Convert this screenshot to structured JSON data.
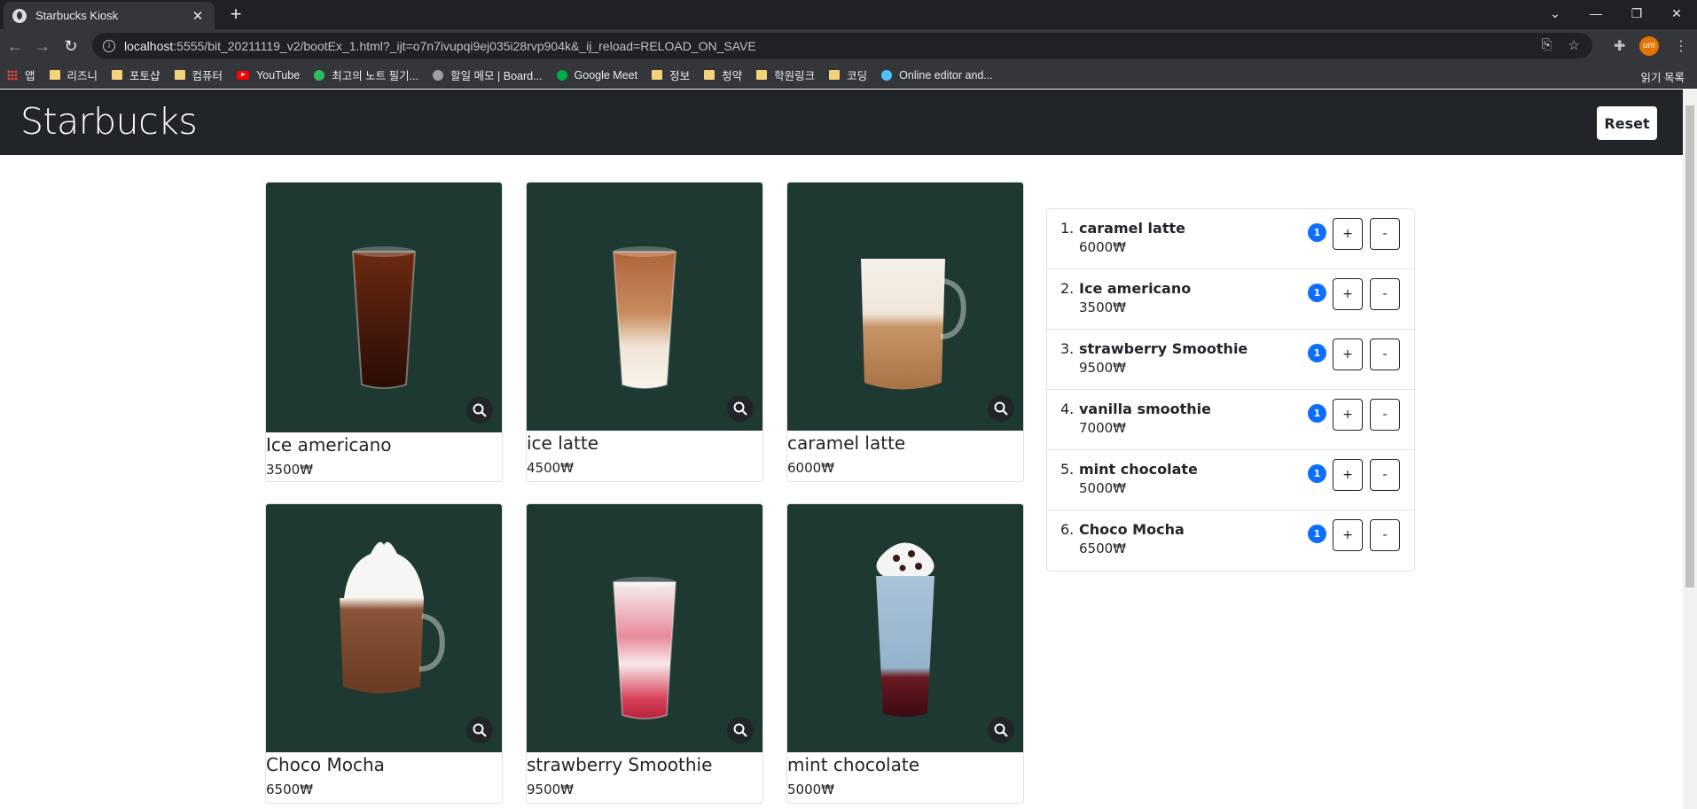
{
  "browser": {
    "tab_title": "Starbucks Kiosk",
    "url_host": "localhost",
    "url_rest": ":5555/bit_20211119_v2/bootEx_1.html?_ijt=o7n7ivupqi9ej035i28rvp904k&_ij_reload=RELOAD_ON_SAVE",
    "profile_initials": "um",
    "bookmarks": [
      {
        "label": "앱",
        "icon": "apps-icon"
      },
      {
        "label": "리즈니",
        "icon": "folder-icon"
      },
      {
        "label": "포토샵",
        "icon": "folder-icon"
      },
      {
        "label": "컴퓨터",
        "icon": "folder-icon"
      },
      {
        "label": "YouTube",
        "icon": "youtube-icon"
      },
      {
        "label": "최고의 노트 필기...",
        "icon": "evernote-icon"
      },
      {
        "label": "할일 메모 | Board...",
        "icon": "check-icon"
      },
      {
        "label": "Google Meet",
        "icon": "meet-icon"
      },
      {
        "label": "정보",
        "icon": "folder-icon"
      },
      {
        "label": "청약",
        "icon": "folder-icon"
      },
      {
        "label": "학원링크",
        "icon": "folder-icon"
      },
      {
        "label": "코딩",
        "icon": "folder-icon"
      },
      {
        "label": "Online editor and...",
        "icon": "editor-icon"
      }
    ],
    "reading_list": "읽기 목록"
  },
  "header": {
    "brand": "Starbucks",
    "reset_label": "Reset"
  },
  "products": [
    {
      "name": "Ice americano",
      "price": "3500₩",
      "drink": "americano"
    },
    {
      "name": "ice latte",
      "price": "4500₩",
      "drink": "latte"
    },
    {
      "name": "caramel latte",
      "price": "6000₩",
      "drink": "caramel"
    },
    {
      "name": "Choco Mocha",
      "price": "6500₩",
      "drink": "mocha"
    },
    {
      "name": "strawberry Smoothie",
      "price": "9500₩",
      "drink": "strawberry"
    },
    {
      "name": "mint chocolate",
      "price": "5000₩",
      "drink": "mint"
    }
  ],
  "orders": [
    {
      "index": "1.",
      "name": "caramel latte",
      "price": "6000₩",
      "qty": "1"
    },
    {
      "index": "2.",
      "name": "Ice americano",
      "price": "3500₩",
      "qty": "1"
    },
    {
      "index": "3.",
      "name": "strawberry Smoothie",
      "price": "9500₩",
      "qty": "1"
    },
    {
      "index": "4.",
      "name": "vanilla smoothie",
      "price": "7000₩",
      "qty": "1"
    },
    {
      "index": "5.",
      "name": "mint chocolate",
      "price": "5000₩",
      "qty": "1"
    },
    {
      "index": "6.",
      "name": "Choco Mocha",
      "price": "6500₩",
      "qty": "1"
    }
  ],
  "order_buttons": {
    "plus": "+",
    "minus": "-"
  },
  "colors": {
    "card_bg": "#1e3932",
    "navbar": "#212529",
    "badge": "#0d6efd"
  }
}
